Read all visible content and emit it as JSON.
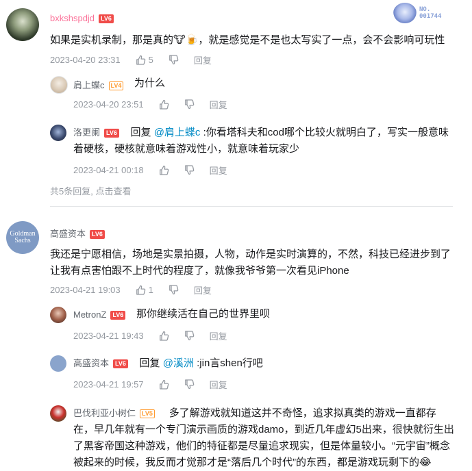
{
  "comments": [
    {
      "user": "bxkshspdjd",
      "level": "LV6",
      "badge_no": "NO.\n001744",
      "text": "如果是实机录制，那是真的🐮🍺，就是感觉是不是也太写实了一点，会不会影响可玩性",
      "time": "2023-04-20 23:31",
      "likes": "5",
      "reply_label": "回复",
      "replies": [
        {
          "user": "肩上蝶c",
          "level": "LV4",
          "text": "为什么",
          "time": "2023-04-20 23:51",
          "likes": "",
          "reply_label": "回复"
        },
        {
          "user": "洛更阑",
          "level": "LV6",
          "reply_prefix": "回复 ",
          "mention": "@肩上蝶c",
          "text": " :你看塔科夫和cod哪个比较火就明白了，写实一般意味着硬核，硬核就意味着游戏性小，就意味着玩家少",
          "time": "2023-04-21 00:18",
          "likes": "",
          "reply_label": "回复"
        }
      ],
      "more_replies": "共5条回复, 点击查看"
    },
    {
      "user": "高盛资本",
      "level": "LV6",
      "avatar_text": "Goldman\nSachs",
      "text": "我还是宁愿相信，场地是实景拍摄，人物，动作是实时演算的，不然，科技已经进步到了让我有点害怕跟不上时代的程度了，就像我爷爷第一次看见iPhone",
      "time": "2023-04-21 19:03",
      "likes": "1",
      "reply_label": "回复",
      "replies": [
        {
          "user": "MetronZ",
          "level": "LV6",
          "text": "那你继续活在自己的世界里呗",
          "time": "2023-04-21 19:43",
          "likes": "",
          "reply_label": "回复"
        },
        {
          "user": "高盛资本",
          "level": "LV6",
          "reply_prefix": "回复 ",
          "mention": "@溪洲",
          "text": " :jin言shen行吧",
          "time": "2023-04-21 19:57",
          "likes": "",
          "reply_label": "回复"
        },
        {
          "user": "巴伐利亚小树仁",
          "level": "LV5",
          "text": "多了解游戏就知道这并不奇怪，追求拟真类的游戏一直都存在，早几年就有一个专门演示画质的游戏damo，到近几年虚幻5出来，很快就衍生出了黑客帝国这种游戏，他们的特征都是尽量追求现实，但是体量较小。“元宇宙”概念被起来的时候，我反而才觉那才是“落后几个时代”的东西，都是游戏玩剩下的😂"
        }
      ]
    }
  ],
  "colors": {
    "level_red": "#f04c49",
    "level_orange": "#ff9a2e",
    "link": "#008ac5",
    "meta": "#9499a0"
  }
}
